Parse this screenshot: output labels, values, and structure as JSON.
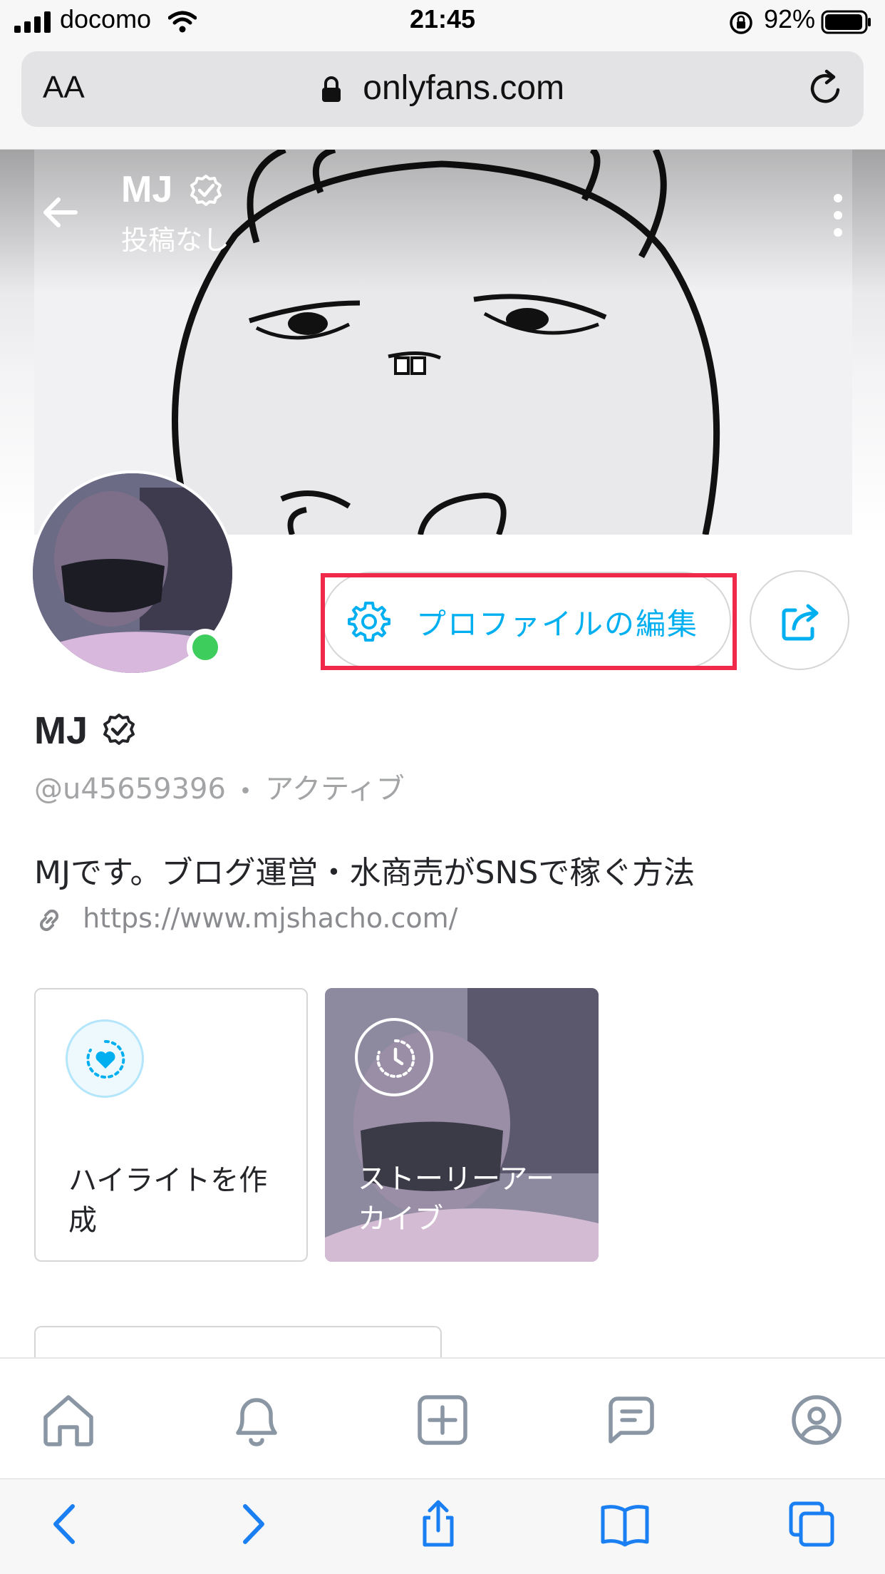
{
  "status_bar": {
    "carrier": "docomo",
    "time": "21:45",
    "battery": "92%"
  },
  "browser": {
    "text_size_label": "AA",
    "url": "onlyfans.com"
  },
  "profile_header": {
    "name": "MJ",
    "subtitle": "投稿なし"
  },
  "actions": {
    "edit_profile_label": "プロファイルの編集"
  },
  "profile": {
    "name": "MJ",
    "handle": "@u45659396",
    "separator": "•",
    "status": "アクティブ",
    "bio": "MJです。ブログ運営・水商売がSNSで稼ぐ方法",
    "website": "https://www.mjshacho.com/"
  },
  "highlights": [
    {
      "label": "ハイライトを作成"
    },
    {
      "label": "ストーリーアーカイブ"
    }
  ],
  "app_nav": [
    "home-icon",
    "bell-icon",
    "plus-square-icon",
    "messages-icon",
    "profile-icon"
  ],
  "safari_toolbar": [
    "back-icon",
    "forward-icon",
    "share-icon",
    "bookmarks-icon",
    "tabs-icon"
  ],
  "colors": {
    "accent": "#00aff0",
    "online": "#3dcd5c",
    "highlight_frame": "#f0284a",
    "ios_blue": "#1a7ff2"
  }
}
